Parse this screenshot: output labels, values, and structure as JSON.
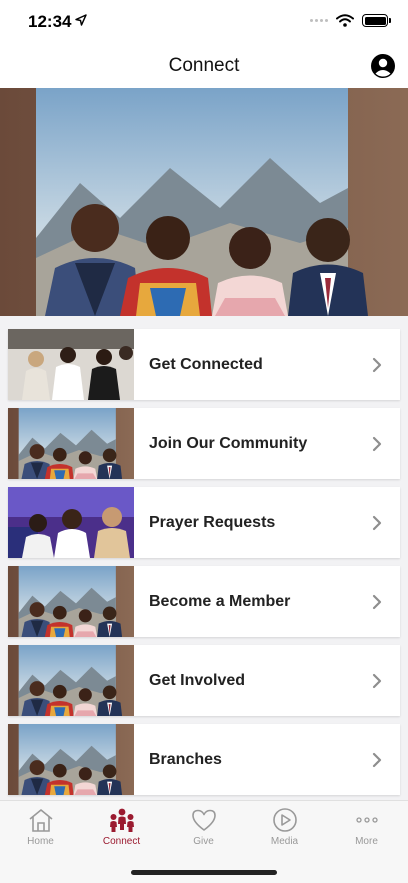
{
  "status_bar": {
    "time": "12:34"
  },
  "nav": {
    "title": "Connect",
    "profile_icon": "user-circle-icon"
  },
  "hero": {
    "image": "group-photo"
  },
  "list": [
    {
      "label": "Get Connected",
      "thumb": "crowd-photo"
    },
    {
      "label": "Join Our Community",
      "thumb": "group-photo"
    },
    {
      "label": "Prayer Requests",
      "thumb": "prayer-photo"
    },
    {
      "label": "Become a Member",
      "thumb": "group-photo"
    },
    {
      "label": "Get Involved",
      "thumb": "group-photo"
    },
    {
      "label": "Branches",
      "thumb": "group-photo"
    }
  ],
  "tabs": [
    {
      "label": "Home",
      "icon": "house-icon",
      "active": false
    },
    {
      "label": "Connect",
      "icon": "people-icon",
      "active": true
    },
    {
      "label": "Give",
      "icon": "heart-icon",
      "active": false
    },
    {
      "label": "Media",
      "icon": "play-icon",
      "active": false
    },
    {
      "label": "More",
      "icon": "ellipsis-icon",
      "active": false
    }
  ],
  "colors": {
    "accent": "#9b1b30",
    "inactive": "#999999",
    "list_background": "#f2f2f4"
  }
}
